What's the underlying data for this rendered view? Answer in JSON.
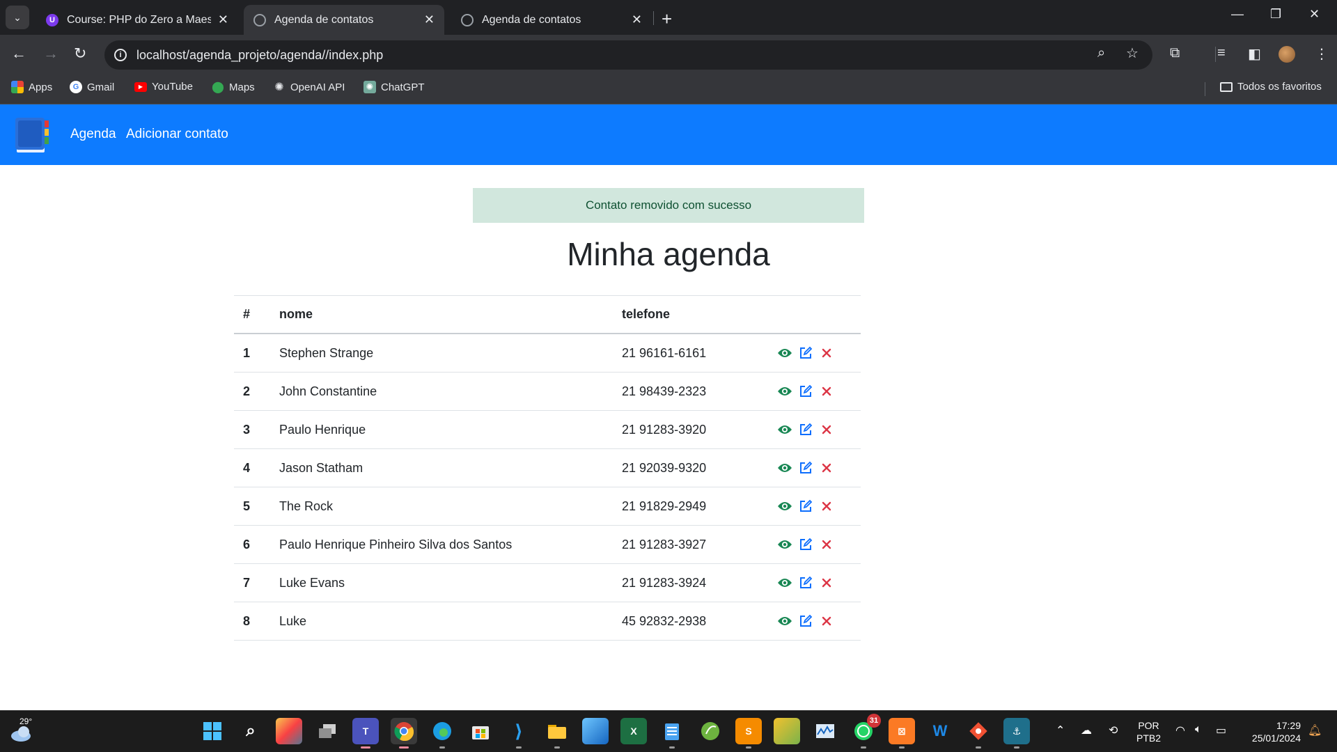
{
  "browser": {
    "tabs": [
      {
        "label": "Course: PHP do Zero a Maestria",
        "active": false
      },
      {
        "label": "Agenda de contatos",
        "active": true
      },
      {
        "label": "Agenda de contatos",
        "active": false
      }
    ],
    "url": "localhost/agenda_projeto/agenda//index.php",
    "bookmarks": [
      {
        "label": "Apps",
        "icon": "apps-grid-icon"
      },
      {
        "label": "Gmail",
        "icon": "google-icon"
      },
      {
        "label": "YouTube",
        "icon": "youtube-icon"
      },
      {
        "label": "Maps",
        "icon": "maps-icon"
      },
      {
        "label": "OpenAI API",
        "icon": "openai-icon"
      },
      {
        "label": "ChatGPT",
        "icon": "chatgpt-icon"
      }
    ],
    "all_bookmarks": "Todos os favoritos"
  },
  "navbar": {
    "links": [
      "Agenda",
      "Adicionar contato"
    ],
    "color": "#0d7bff"
  },
  "alert": {
    "message": "Contato removido com sucesso"
  },
  "page": {
    "title": "Minha agenda"
  },
  "table": {
    "headers": [
      "#",
      "nome",
      "telefone"
    ],
    "rows": [
      {
        "id": "1",
        "name": "Stephen Strange",
        "phone": "21 96161-6161"
      },
      {
        "id": "2",
        "name": "John Constantine",
        "phone": "21 98439-2323"
      },
      {
        "id": "3",
        "name": "Paulo Henrique",
        "phone": "21 91283-3920"
      },
      {
        "id": "4",
        "name": "Jason Statham",
        "phone": "21 92039-9320"
      },
      {
        "id": "5",
        "name": "The Rock",
        "phone": "21 91829-2949"
      },
      {
        "id": "6",
        "name": "Paulo Henrique Pinheiro Silva dos Santos",
        "phone": "21 91283-3927"
      },
      {
        "id": "7",
        "name": "Luke Evans",
        "phone": "21 91283-3924"
      },
      {
        "id": "8",
        "name": "Luke",
        "phone": "45 92832-2938"
      }
    ],
    "action_colors": {
      "view": "#198754",
      "edit": "#0d6efd",
      "delete": "#dc3545"
    }
  },
  "taskbar": {
    "temperature": "29°",
    "whatsapp_badge": "31",
    "language": "POR",
    "layout": "PTB2",
    "time": "17:29",
    "date": "25/01/2024"
  }
}
